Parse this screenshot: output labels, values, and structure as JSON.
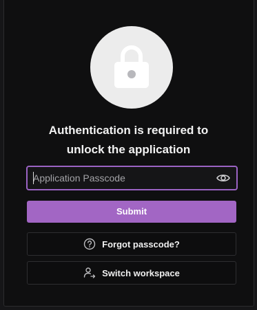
{
  "icons": {
    "lock": "lock-icon",
    "eye": "eye-icon",
    "help": "help-circle-icon",
    "switch": "user-switch-icon"
  },
  "auth": {
    "heading_line1": "Authentication is required to",
    "heading_line2": "unlock the application",
    "passcode_placeholder": "Application Passcode",
    "passcode_value": "",
    "submit_label": "Submit",
    "forgot_label": "Forgot passcode?",
    "switch_label": "Switch workspace"
  },
  "colors": {
    "accent": "#a266c4",
    "focus_border": "#9b63c4",
    "background": "#0f0f10",
    "lock_circle": "#ececec"
  }
}
